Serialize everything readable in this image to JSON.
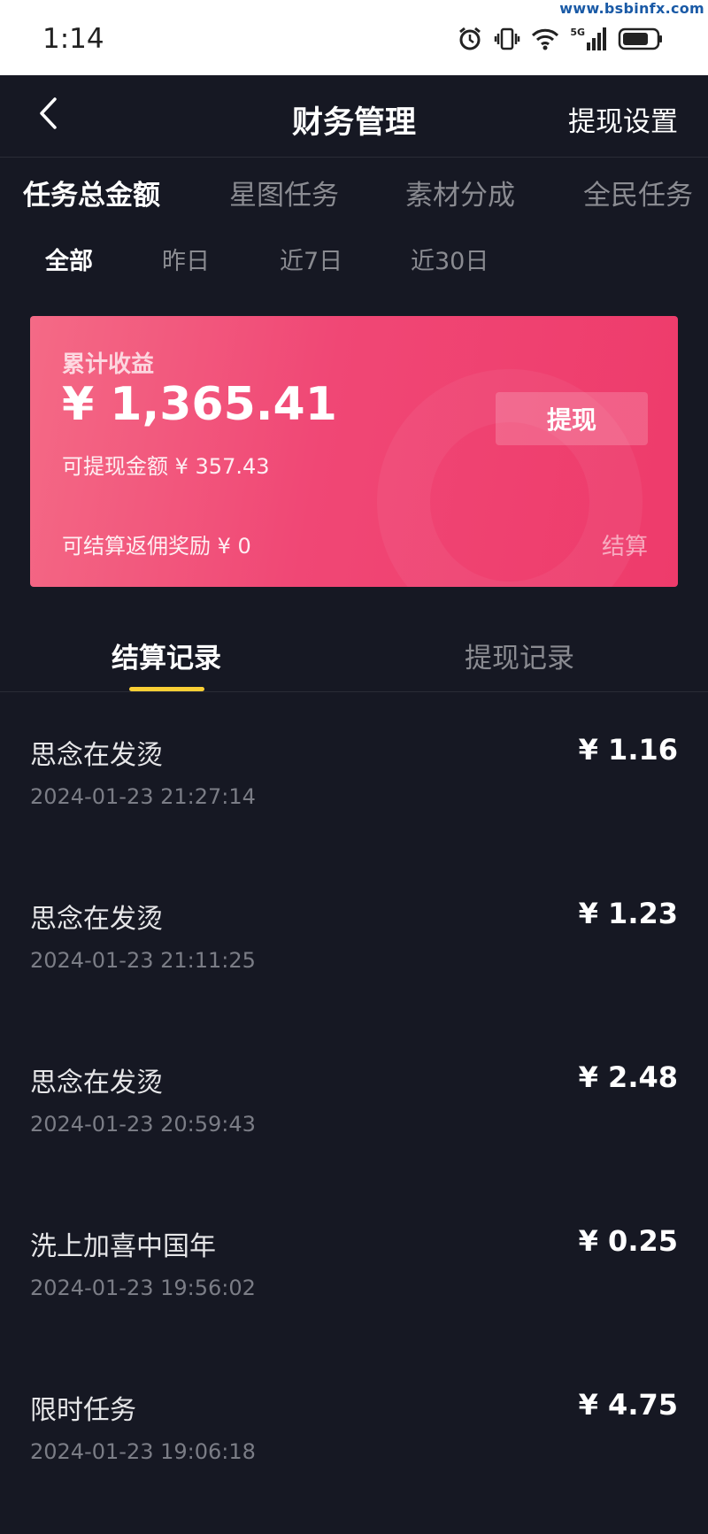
{
  "status_bar": {
    "time": "1:14",
    "watermark": "www.bsbinfx.com",
    "icons": [
      "alarm-icon",
      "vibrate-icon",
      "wifi-icon",
      "signal-5g-icon",
      "battery-icon"
    ],
    "signal_label": "5G"
  },
  "header": {
    "back_icon": "chevron-left-icon",
    "title": "财务管理",
    "action_label": "提现设置"
  },
  "category_tabs": [
    {
      "label": "任务总金额",
      "active": true
    },
    {
      "label": "星图任务",
      "active": false
    },
    {
      "label": "素材分成",
      "active": false
    },
    {
      "label": "全民任务",
      "active": false
    }
  ],
  "period_filters": [
    {
      "label": "全部",
      "active": true
    },
    {
      "label": "昨日",
      "active": false
    },
    {
      "label": "近7日",
      "active": false
    },
    {
      "label": "近30日",
      "active": false
    }
  ],
  "earnings_card": {
    "label": "累计收益",
    "total": "¥ 1,365.41",
    "withdrawable": "可提现金额 ¥ 357.43",
    "withdraw_button": "提现",
    "commission": "可结算返佣奖励 ¥ 0",
    "settle_label": "结算",
    "colors": {
      "gradient_start": "#f46a86",
      "gradient_end": "#ee3b6b"
    }
  },
  "record_tabs": [
    {
      "label": "结算记录",
      "active": true
    },
    {
      "label": "提现记录",
      "active": false
    }
  ],
  "records": [
    {
      "title": "思念在发烫",
      "time": "2024-01-23 21:27:14",
      "amount": "¥ 1.16"
    },
    {
      "title": "思念在发烫",
      "time": "2024-01-23 21:11:25",
      "amount": "¥ 1.23"
    },
    {
      "title": "思念在发烫",
      "time": "2024-01-23 20:59:43",
      "amount": "¥ 2.48"
    },
    {
      "title": "洗上加喜中国年",
      "time": "2024-01-23 19:56:02",
      "amount": "¥ 0.25"
    },
    {
      "title": "限时任务",
      "time": "2024-01-23 19:06:18",
      "amount": "¥ 4.75"
    }
  ],
  "colors": {
    "background": "#161823",
    "accent_indicator": "#facf35",
    "muted_text": "#8a8b91"
  }
}
